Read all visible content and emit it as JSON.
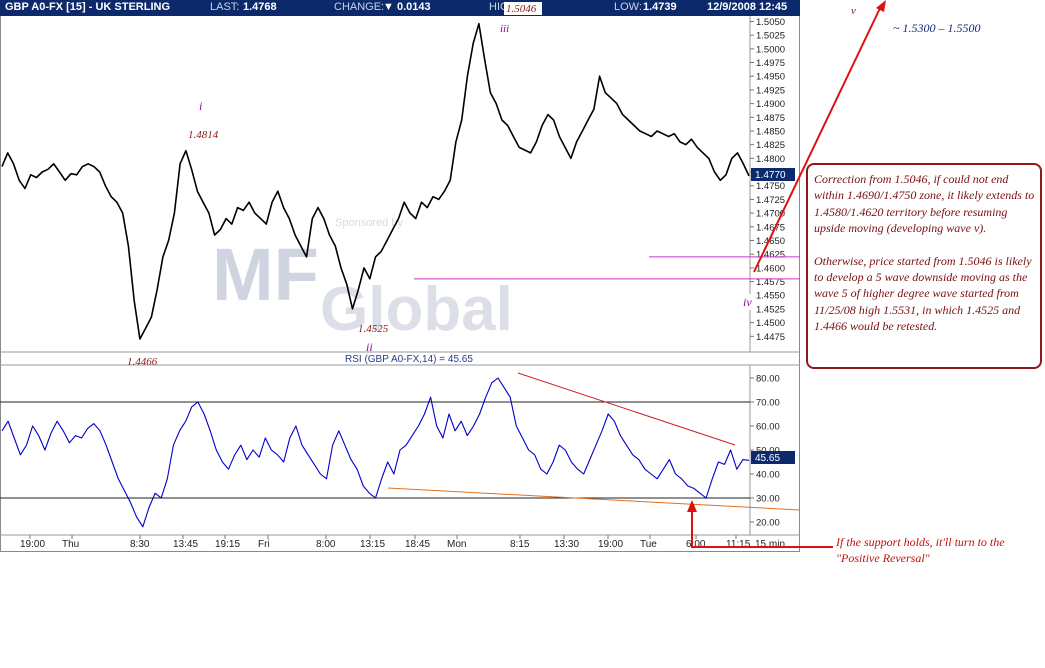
{
  "header": {
    "title": "GBP A0-FX [15] - UK STERLING",
    "last_label": "LAST:",
    "last_value": "1.4768",
    "change_label": "CHANGE:",
    "change_value": "0.0143",
    "high_label": "HIG",
    "low_label": "LOW:",
    "low_value": "1.4739",
    "date_time": "12/9/2008 12:45"
  },
  "colors": {
    "header_bg": "#0c2a6b",
    "price_line": "#000000",
    "rsi_line": "#0000cc",
    "wave_label": "#8b0a8b",
    "price_annotation": "#8b1a1a",
    "trend_upper": "#cc2222",
    "trend_lower": "#e07020",
    "horizontal_level": "#cc33cc",
    "callout_border": "#8b1a1a",
    "arrow": "#dd1111",
    "last_price_tag": "#0c2a6b"
  },
  "watermark": {
    "sponsor_text": "Sponsored by",
    "logo_text_1": "MF",
    "logo_text_2": "Global"
  },
  "annotations": {
    "wave_i": "i",
    "wave_ii": "ii",
    "wave_iii": "iii",
    "wave_iv": "iv",
    "wave_v": "v",
    "price_i": "1.4814",
    "price_ii": "1.4525",
    "price_iii": "1.5046",
    "price_low": "1.4466",
    "target": "~ 1.5300 – 1.5500",
    "callout_para1": "Correction from 1.5046, if could not end within 1.4690/1.4750 zone, it likely extends to 1.4580/1.4620 territory before resuming upside moving (developing wave v).",
    "callout_para2": "Otherwise, price started from 1.5046 is likely to develop a 5 wave downside moving as the wave 5 of higher degree wave started from 11/25/08 high 1.5531, in which 1.4525 and 1.4466 would be retested.",
    "support_note": "If the support holds, it'll turn to the \"Positive Reversal\""
  },
  "chart_data": [
    {
      "type": "line",
      "name": "price",
      "title": "GBP A0-FX [15] - UK STERLING",
      "ylim": [
        1.445,
        1.506
      ],
      "yticks": [
        "1.5050",
        "1.5025",
        "1.5000",
        "1.4975",
        "1.4950",
        "1.4925",
        "1.4900",
        "1.4875",
        "1.4850",
        "1.4825",
        "1.4800",
        "1.4775",
        "1.4750",
        "1.4725",
        "1.4700",
        "1.4675",
        "1.4650",
        "1.4625",
        "1.4600",
        "1.4575",
        "1.4550",
        "1.4525",
        "1.4500",
        "1.4475"
      ],
      "last_price_tag": "1.4770",
      "levels": [
        1.462,
        1.458
      ],
      "series": [
        {
          "values": [
            1.4785,
            1.481,
            1.479,
            1.476,
            1.4745,
            1.477,
            1.4765,
            1.4775,
            1.478,
            1.479,
            1.4775,
            1.476,
            1.4772,
            1.477,
            1.4785,
            1.479,
            1.4785,
            1.4775,
            1.475,
            1.473,
            1.472,
            1.47,
            1.464,
            1.454,
            1.447,
            1.449,
            1.451,
            1.456,
            1.462,
            1.465,
            1.47,
            1.479,
            1.4814,
            1.478,
            1.474,
            1.472,
            1.47,
            1.466,
            1.467,
            1.469,
            1.468,
            1.471,
            1.4705,
            1.472,
            1.47,
            1.469,
            1.468,
            1.472,
            1.474,
            1.471,
            1.469,
            1.466,
            1.464,
            1.462,
            1.469,
            1.471,
            1.469,
            1.466,
            1.464,
            1.46,
            1.457,
            1.4525,
            1.456,
            1.46,
            1.458,
            1.462,
            1.463,
            1.465,
            1.467,
            1.469,
            1.472,
            1.47,
            1.469,
            1.472,
            1.471,
            1.473,
            1.4725,
            1.474,
            1.476,
            1.483,
            1.487,
            1.495,
            1.501,
            1.5046,
            1.498,
            1.492,
            1.49,
            1.487,
            1.486,
            1.484,
            1.482,
            1.4815,
            1.481,
            1.483,
            1.486,
            1.488,
            1.487,
            1.484,
            1.482,
            1.48,
            1.483,
            1.485,
            1.487,
            1.489,
            1.495,
            1.492,
            1.491,
            1.49,
            1.488,
            1.487,
            1.486,
            1.485,
            1.4845,
            1.484,
            1.485,
            1.4845,
            1.484,
            1.4845,
            1.483,
            1.4825,
            1.4835,
            1.482,
            1.481,
            1.48,
            1.4775,
            1.476,
            1.477,
            1.48,
            1.481,
            1.479,
            1.4768
          ]
        }
      ],
      "xticks": [
        "19:00",
        "Thu",
        "8:30",
        "13:45",
        "19:15",
        "Fri",
        "8:00",
        "13:15",
        "18:45",
        "Mon",
        "8:15",
        "13:30",
        "19:00",
        "Tue",
        "6:00",
        "11:15"
      ],
      "xunit": "15 min."
    },
    {
      "type": "line",
      "name": "rsi",
      "title": "RSI (GBP A0-FX,14) = 45.65",
      "ylim": [
        15,
        85
      ],
      "yticks": [
        "80.00",
        "70.00",
        "60.00",
        "50.00",
        "40.00",
        "30.00",
        "20.00"
      ],
      "reference_lines": [
        70,
        30
      ],
      "last_value_tag": "45.65",
      "series": [
        {
          "values": [
            58,
            62,
            55,
            48,
            52,
            60,
            56,
            50,
            57,
            62,
            58,
            53,
            56,
            55,
            59,
            61,
            58,
            52,
            45,
            38,
            33,
            28,
            22,
            18,
            26,
            32,
            30,
            38,
            52,
            58,
            62,
            68,
            70,
            65,
            58,
            50,
            45,
            42,
            48,
            52,
            46,
            50,
            47,
            55,
            50,
            48,
            45,
            55,
            60,
            52,
            48,
            44,
            40,
            38,
            52,
            58,
            52,
            46,
            42,
            35,
            32,
            30,
            38,
            45,
            40,
            50,
            52,
            56,
            60,
            65,
            72,
            60,
            55,
            65,
            58,
            62,
            56,
            60,
            65,
            72,
            78,
            80,
            76,
            72,
            60,
            55,
            50,
            48,
            42,
            40,
            45,
            52,
            50,
            45,
            42,
            40,
            46,
            52,
            58,
            65,
            62,
            56,
            52,
            48,
            46,
            42,
            40,
            38,
            42,
            46,
            40,
            38,
            35,
            34,
            32,
            30,
            38,
            45,
            44,
            50,
            42,
            46,
            45.65
          ]
        }
      ]
    }
  ]
}
